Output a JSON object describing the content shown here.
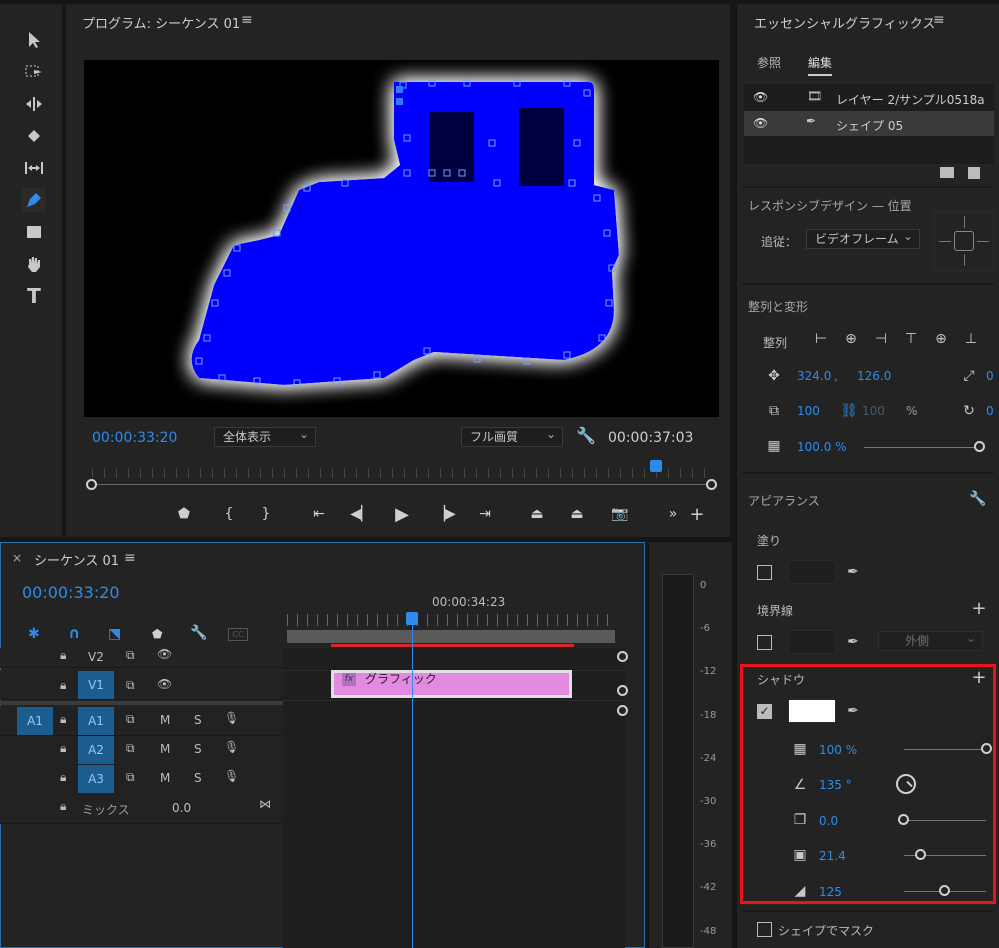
{
  "program": {
    "title": "プログラム: シーケンス 01",
    "timecode_current": "00:00:33:20",
    "zoom": "全体表示",
    "quality": "フル画質",
    "timecode_duration": "00:00:37:03"
  },
  "timeline": {
    "tab": "シーケンス 01",
    "timecode": "00:00:33:20",
    "ruler_time": "00:00:34:23",
    "clip_label": "グラフィック",
    "tracks": [
      {
        "name": "V2"
      },
      {
        "name": "V1"
      },
      {
        "name": "A1",
        "source": "A1",
        "m": "M",
        "s": "S"
      },
      {
        "name": "A2",
        "m": "M",
        "s": "S"
      },
      {
        "name": "A3",
        "m": "M",
        "s": "S"
      }
    ],
    "mix_label": "ミックス",
    "mix_value": "0.0"
  },
  "meter": {
    "levels": [
      "0",
      "-6",
      "-12",
      "-18",
      "-24",
      "-30",
      "-36",
      "-42",
      "-48"
    ]
  },
  "eg": {
    "title": "エッセンシャルグラフィックス",
    "tab_browse": "参照",
    "tab_edit": "編集",
    "layers": [
      {
        "name": "レイヤー 2/サンプル0518a"
      },
      {
        "name": "シェイプ 05"
      }
    ],
    "responsive_title": "レスポンシブデザイン — 位置",
    "follow_label": "追従：",
    "follow_value": "ビデオフレーム",
    "align_title": "整列と変形",
    "align_label": "整列",
    "pos_x": "324.0",
    "pos_sep": ",",
    "pos_y": "126.0",
    "anchor_x": "0",
    "scale": "100",
    "scale_locked": "100",
    "scale_unit": "%",
    "rotation": "0",
    "opacity": "100.0 %",
    "appearance_title": "アピアランス",
    "fill_label": "塗り",
    "stroke_label": "境界線",
    "stroke_type": "外側",
    "shadow_label": "シャドウ",
    "shadow_opacity": "100 %",
    "shadow_angle": "135 °",
    "shadow_distance": "0.0",
    "shadow_size": "21.4",
    "shadow_blur": "125",
    "mask_label": "シェイプでマスク",
    "shadow_color": "#ffffff",
    "highlight_color": "#e8141c"
  },
  "shape_color": "#0000ff"
}
